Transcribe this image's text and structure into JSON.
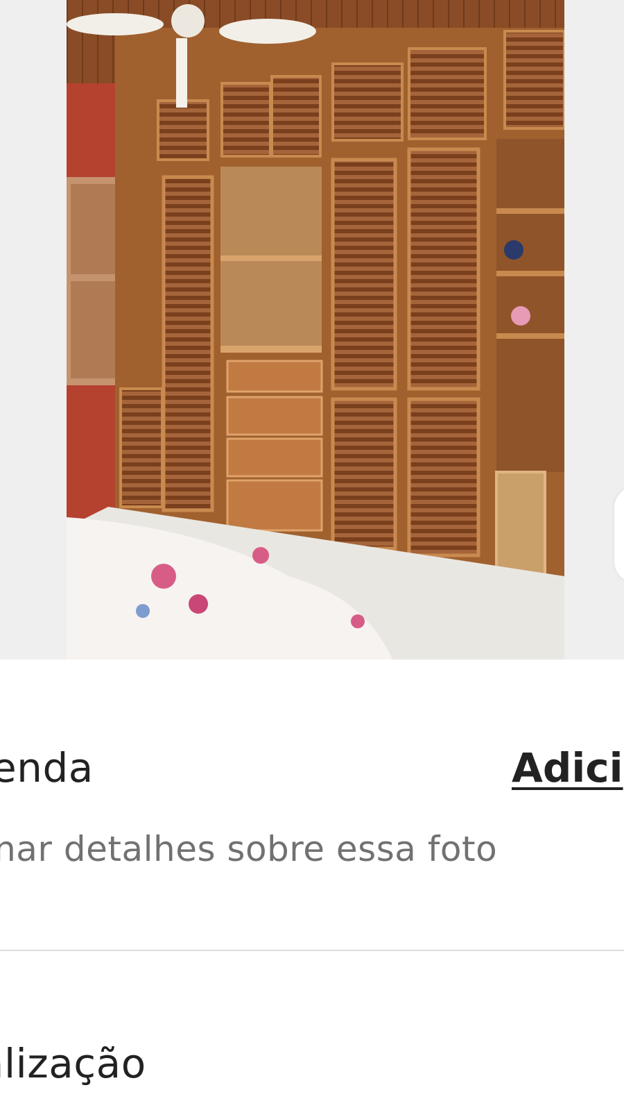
{
  "photo": {
    "icon": "photo-bedroom-wardrobe",
    "accent_colors": {
      "wood": "#a0612f",
      "wall": "#b5412f",
      "floor": "#e9e7e2"
    }
  },
  "caption": {
    "title": "enda",
    "add_label": "Adici",
    "subtitle": "onar detalhes sobre essa foto"
  },
  "location_section": {
    "title": "alização"
  }
}
